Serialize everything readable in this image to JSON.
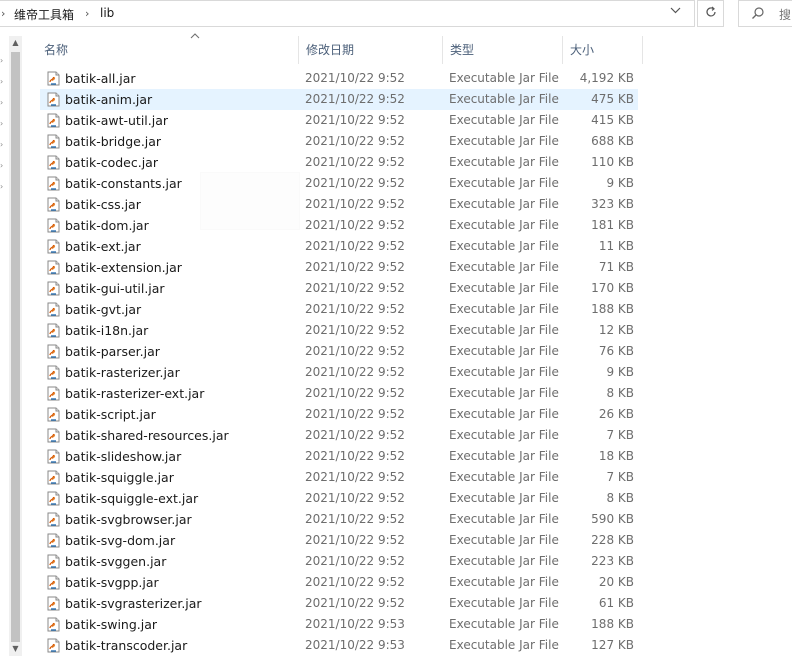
{
  "breadcrumb": [
    "维帝工具箱",
    "lib"
  ],
  "search": {
    "placeholder": "搜"
  },
  "columns": {
    "name": "名称",
    "date": "修改日期",
    "type": "类型",
    "size": "大小"
  },
  "files": [
    {
      "name": "batik-all.jar",
      "date": "2021/10/22 9:52",
      "type": "Executable Jar File",
      "size": "4,192 KB"
    },
    {
      "name": "batik-anim.jar",
      "date": "2021/10/22 9:52",
      "type": "Executable Jar File",
      "size": "475 KB",
      "selected": true
    },
    {
      "name": "batik-awt-util.jar",
      "date": "2021/10/22 9:52",
      "type": "Executable Jar File",
      "size": "415 KB"
    },
    {
      "name": "batik-bridge.jar",
      "date": "2021/10/22 9:52",
      "type": "Executable Jar File",
      "size": "688 KB"
    },
    {
      "name": "batik-codec.jar",
      "date": "2021/10/22 9:52",
      "type": "Executable Jar File",
      "size": "110 KB"
    },
    {
      "name": "batik-constants.jar",
      "date": "2021/10/22 9:52",
      "type": "Executable Jar File",
      "size": "9 KB"
    },
    {
      "name": "batik-css.jar",
      "date": "2021/10/22 9:52",
      "type": "Executable Jar File",
      "size": "323 KB"
    },
    {
      "name": "batik-dom.jar",
      "date": "2021/10/22 9:52",
      "type": "Executable Jar File",
      "size": "181 KB"
    },
    {
      "name": "batik-ext.jar",
      "date": "2021/10/22 9:52",
      "type": "Executable Jar File",
      "size": "11 KB"
    },
    {
      "name": "batik-extension.jar",
      "date": "2021/10/22 9:52",
      "type": "Executable Jar File",
      "size": "71 KB"
    },
    {
      "name": "batik-gui-util.jar",
      "date": "2021/10/22 9:52",
      "type": "Executable Jar File",
      "size": "170 KB"
    },
    {
      "name": "batik-gvt.jar",
      "date": "2021/10/22 9:52",
      "type": "Executable Jar File",
      "size": "188 KB"
    },
    {
      "name": "batik-i18n.jar",
      "date": "2021/10/22 9:52",
      "type": "Executable Jar File",
      "size": "12 KB"
    },
    {
      "name": "batik-parser.jar",
      "date": "2021/10/22 9:52",
      "type": "Executable Jar File",
      "size": "76 KB"
    },
    {
      "name": "batik-rasterizer.jar",
      "date": "2021/10/22 9:52",
      "type": "Executable Jar File",
      "size": "9 KB"
    },
    {
      "name": "batik-rasterizer-ext.jar",
      "date": "2021/10/22 9:52",
      "type": "Executable Jar File",
      "size": "8 KB"
    },
    {
      "name": "batik-script.jar",
      "date": "2021/10/22 9:52",
      "type": "Executable Jar File",
      "size": "26 KB"
    },
    {
      "name": "batik-shared-resources.jar",
      "date": "2021/10/22 9:52",
      "type": "Executable Jar File",
      "size": "7 KB"
    },
    {
      "name": "batik-slideshow.jar",
      "date": "2021/10/22 9:52",
      "type": "Executable Jar File",
      "size": "18 KB"
    },
    {
      "name": "batik-squiggle.jar",
      "date": "2021/10/22 9:52",
      "type": "Executable Jar File",
      "size": "7 KB"
    },
    {
      "name": "batik-squiggle-ext.jar",
      "date": "2021/10/22 9:52",
      "type": "Executable Jar File",
      "size": "8 KB"
    },
    {
      "name": "batik-svgbrowser.jar",
      "date": "2021/10/22 9:52",
      "type": "Executable Jar File",
      "size": "590 KB"
    },
    {
      "name": "batik-svg-dom.jar",
      "date": "2021/10/22 9:52",
      "type": "Executable Jar File",
      "size": "228 KB"
    },
    {
      "name": "batik-svggen.jar",
      "date": "2021/10/22 9:52",
      "type": "Executable Jar File",
      "size": "223 KB"
    },
    {
      "name": "batik-svgpp.jar",
      "date": "2021/10/22 9:52",
      "type": "Executable Jar File",
      "size": "20 KB"
    },
    {
      "name": "batik-svgrasterizer.jar",
      "date": "2021/10/22 9:52",
      "type": "Executable Jar File",
      "size": "61 KB"
    },
    {
      "name": "batik-swing.jar",
      "date": "2021/10/22 9:53",
      "type": "Executable Jar File",
      "size": "188 KB"
    },
    {
      "name": "batik-transcoder.jar",
      "date": "2021/10/22 9:53",
      "type": "Executable Jar File",
      "size": "127 KB"
    }
  ],
  "colors": {
    "selection": "#e5f3ff",
    "header_text": "#4c607a",
    "meta_text": "#6d6d6d"
  },
  "icons": {
    "file": "jar-file-icon",
    "refresh": "refresh-icon",
    "search": "search-icon",
    "dropdown": "chevron-down-icon"
  }
}
